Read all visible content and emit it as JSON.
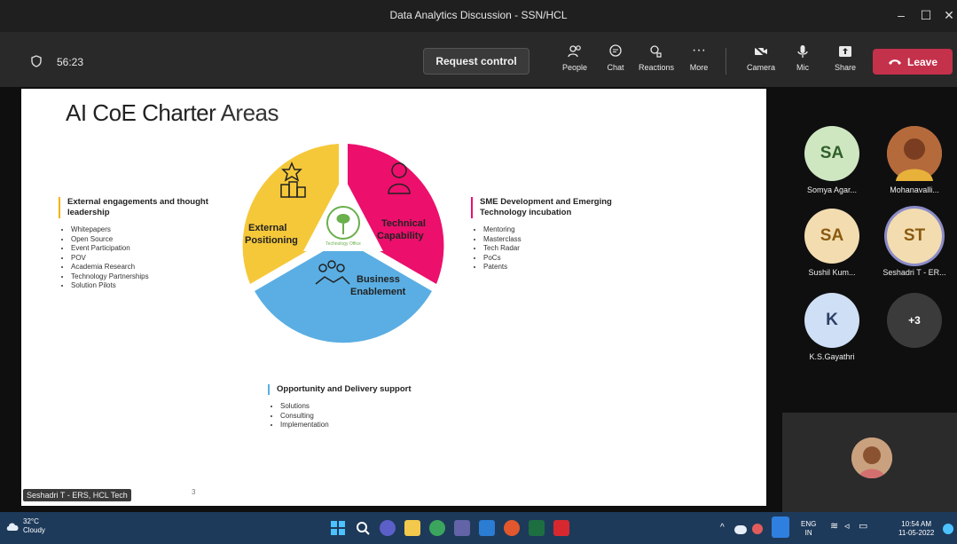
{
  "window": {
    "title": "Data Analytics Discussion - SSN/HCL",
    "controls": [
      "–",
      "☐",
      "✕"
    ]
  },
  "meeting": {
    "timer": "56:23",
    "request_control": "Request control",
    "buttons": {
      "people": "People",
      "chat": "Chat",
      "reactions": "Reactions",
      "more": "More",
      "camera": "Camera",
      "mic": "Mic",
      "share": "Share"
    },
    "leave": "Leave"
  },
  "slide": {
    "title_main": "AI CoE Charter",
    "title_areas": " Areas",
    "left": {
      "heading": "External engagements and thought leadership",
      "items": [
        "Whitepapers",
        "Open Source",
        "Event Participation",
        "POV",
        "Academia Research",
        "Technology Partnerships",
        "Solution Pilots"
      ]
    },
    "right": {
      "heading": "SME Development and Emerging Technology incubation",
      "items": [
        "Mentoring",
        "Masterclass",
        "Tech Radar",
        "PoCs",
        "Patents"
      ]
    },
    "bottom": {
      "heading": "Opportunity and Delivery support",
      "items": [
        "Solutions",
        "Consulting",
        "Implementation"
      ]
    },
    "segments": {
      "external": "External Positioning",
      "technical": "Technical Capability",
      "business": "Business Enablement"
    },
    "center_label": "Technology Office",
    "page_number": "3",
    "colors": {
      "yellow": "#f5c83a",
      "pink": "#ec0f6c",
      "blue": "#5aaee3"
    }
  },
  "speaker_label": "Seshadri T - ERS, HCL Tech",
  "participants": [
    {
      "initials": "SA",
      "name": "Somya Agar...",
      "bg": "#cfe7c1",
      "fg": "#2f5f2a"
    },
    {
      "initials": "",
      "name": "Mohanavalli...",
      "bg": "#b56a3c",
      "fg": "#ffffff"
    },
    {
      "initials": "SA",
      "name": "Sushil Kum...",
      "bg": "#f3ddb0",
      "fg": "#8a5a10"
    },
    {
      "initials": "ST",
      "name": "Seshadri T - ER...",
      "bg": "#f3ddb0",
      "fg": "#8a5a10"
    },
    {
      "initials": "K",
      "name": "K.S.Gayathri",
      "bg": "#cfdff5",
      "fg": "#2b3f66"
    },
    {
      "initials": "+3",
      "name": "",
      "bg": "#3b3b3b",
      "fg": "#ffffff"
    }
  ],
  "taskbar": {
    "weather_temp": "32°C",
    "weather_desc": "Cloudy",
    "lang1": "ENG",
    "lang2": "IN",
    "time": "10:54 AM",
    "date": "11-05-2022"
  }
}
